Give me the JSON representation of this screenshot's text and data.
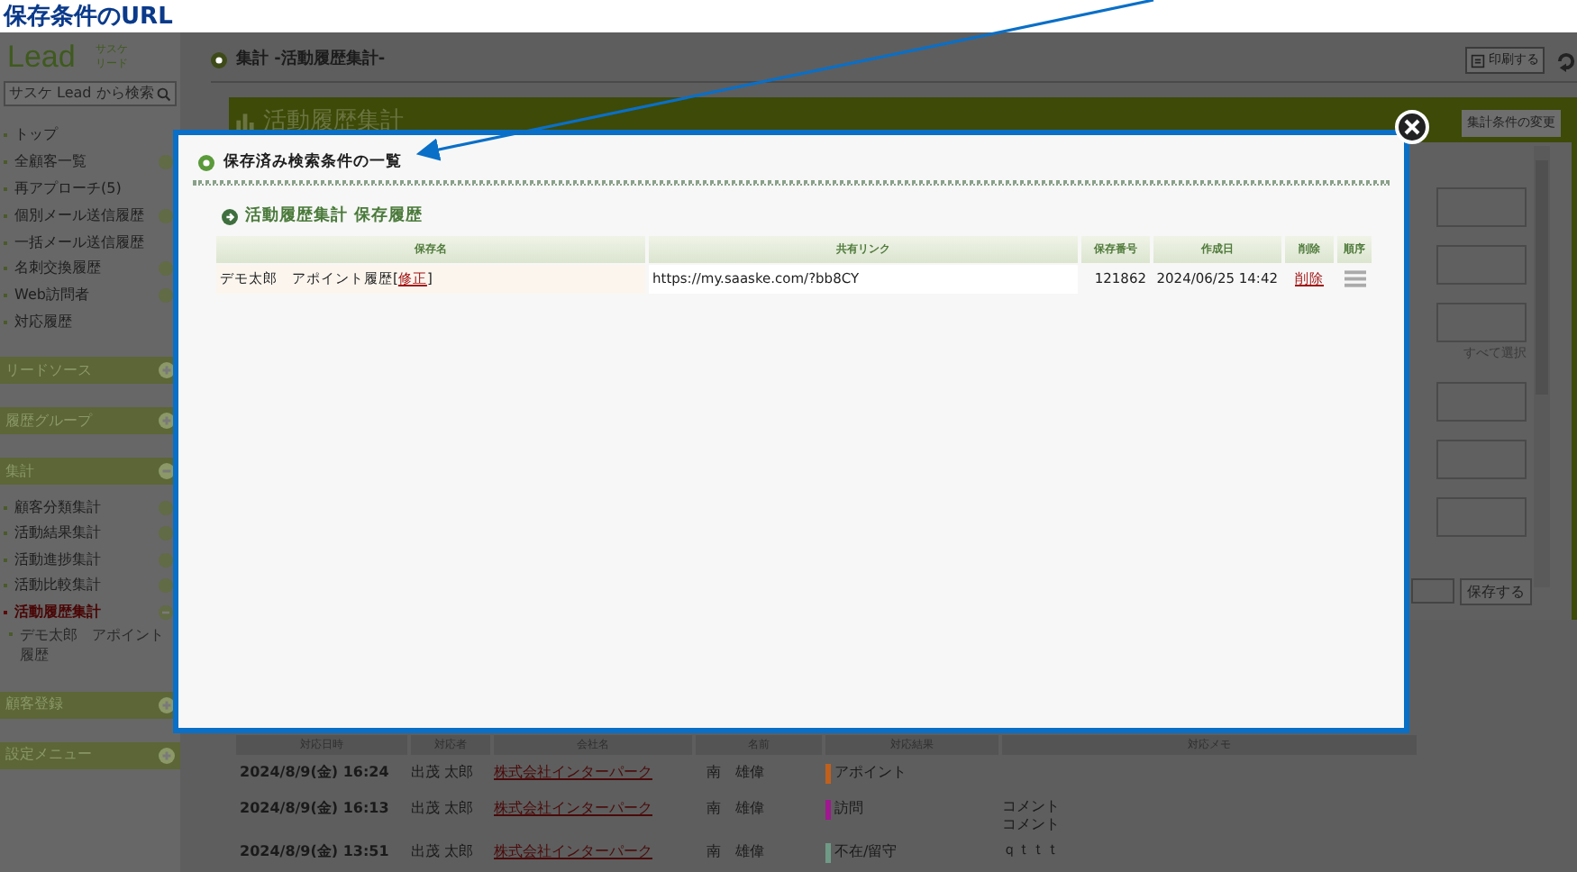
{
  "annotation": {
    "title": "保存条件のURL"
  },
  "sidebar": {
    "logo": "Lead",
    "logo_sub": [
      "サスケ",
      "リード"
    ],
    "search": {
      "placeholder": "サスケ Lead から検索"
    },
    "nav_items": [
      {
        "label": "トップ",
        "has_submenu": false
      },
      {
        "label": "全顧客一覧",
        "has_submenu": true
      },
      {
        "label": "再アプローチ(5)",
        "has_submenu": false
      },
      {
        "label": "個別メール送信履歴",
        "has_submenu": true
      },
      {
        "label": "一括メール送信履歴",
        "has_submenu": false
      },
      {
        "label": "名刺交換履歴",
        "has_submenu": true
      },
      {
        "label": "Web訪問者",
        "has_submenu": true
      },
      {
        "label": "対応履歴",
        "has_submenu": false
      }
    ],
    "sections": [
      {
        "label": "リードソース",
        "expanded": false
      },
      {
        "label": "履歴グループ",
        "expanded": false
      },
      {
        "label": "集計",
        "expanded": true,
        "items": [
          {
            "label": "顧客分類集計",
            "selected": false
          },
          {
            "label": "活動結果集計",
            "selected": false
          },
          {
            "label": "活動進捗集計",
            "selected": false
          },
          {
            "label": "活動比較集計",
            "selected": false
          },
          {
            "label": "活動履歴集計",
            "selected": true,
            "children": [
              {
                "label": "デモ太郎　アポイント履歴"
              }
            ]
          }
        ]
      },
      {
        "label": "顧客登録",
        "expanded": false
      },
      {
        "label": "設定メニュー",
        "expanded": false
      }
    ]
  },
  "header": {
    "title": "集計 -活動履歴集計-",
    "print_button": "印刷する"
  },
  "panel": {
    "title": "活動履歴集計",
    "change_button": "集計条件の変更",
    "select_all": "すべて選択",
    "save_button": "保存する"
  },
  "history_table": {
    "columns": [
      "対応日時",
      "対応者",
      "会社名",
      "名前",
      "対応結果",
      "対応メモ"
    ],
    "rows": [
      {
        "datetime": "2024/8/9(金) 16:24",
        "staff": "出茂 太郎",
        "company": "株式会社インターパーク",
        "name": "南　雄偉",
        "result": "アポイント",
        "color": "#c0601c"
      },
      {
        "datetime": "2024/8/9(金) 16:13",
        "staff": "出茂 太郎",
        "company": "株式会社インターパーク",
        "name": "南　雄偉",
        "result": "訪問",
        "color": "#a01890",
        "memo": "コメントコメント"
      },
      {
        "datetime": "2024/8/9(金) 13:51",
        "staff": "出茂 太郎",
        "company": "株式会社インターパーク",
        "name": "南　雄偉",
        "result": "不在/留守",
        "color": "#6f9a86",
        "memo": "ｑｔｔｔ"
      }
    ]
  },
  "modal": {
    "title": "保存済み検索条件の一覧",
    "subtitle": "活動履歴集計 保存履歴",
    "columns": [
      "保存名",
      "共有リンク",
      "保存番号",
      "作成日",
      "削除",
      "順序"
    ],
    "rows": [
      {
        "name": "デモ太郎　アポイント履歴[",
        "edit_link": "修正",
        "name_close": "]",
        "url": "https://my.saaske.com/?bb8CY",
        "number": "121862",
        "created": "2024/06/25 14:42",
        "delete_link": "削除"
      }
    ]
  }
}
